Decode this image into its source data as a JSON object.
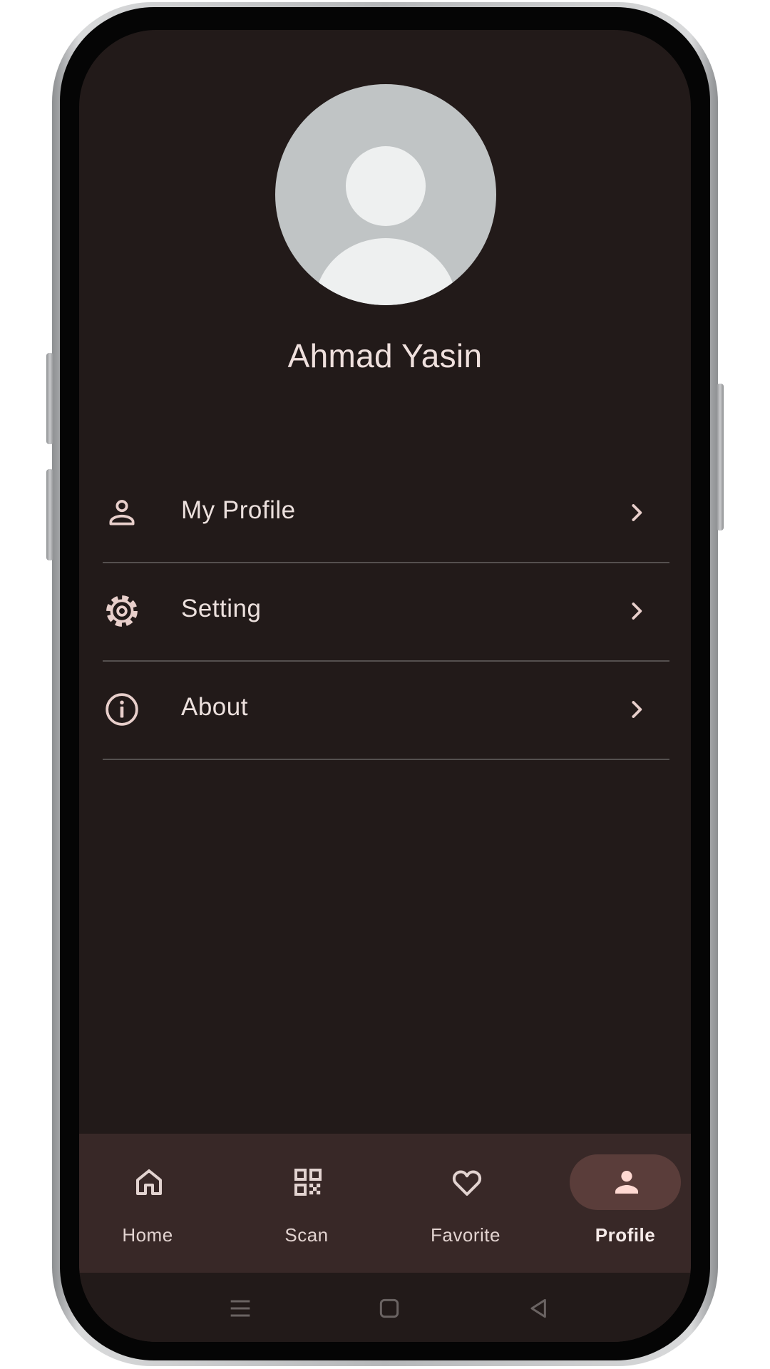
{
  "profile": {
    "name": "Ahmad Yasin",
    "avatar_icon": "default-avatar-placeholder"
  },
  "menu": {
    "items": [
      {
        "label": "My Profile",
        "icon": "person-outline-icon"
      },
      {
        "label": "Setting",
        "icon": "gear-icon"
      },
      {
        "label": "About",
        "icon": "info-circle-icon"
      }
    ],
    "chevron_icon": "chevron-right-icon"
  },
  "bottom_nav": {
    "items": [
      {
        "label": "Home",
        "icon": "home-icon",
        "active": false
      },
      {
        "label": "Scan",
        "icon": "qr-code-icon",
        "active": false
      },
      {
        "label": "Favorite",
        "icon": "heart-icon",
        "active": false
      },
      {
        "label": "Profile",
        "icon": "person-filled-icon",
        "active": true
      }
    ]
  },
  "system_nav": {
    "buttons": [
      "recents-icon",
      "home-square-icon",
      "back-triangle-icon"
    ]
  },
  "colors": {
    "background": "#221a19",
    "nav_bar": "#382827",
    "active_pill": "#5a3d3a",
    "text": "#efe0dd",
    "icon": "#e8cfcb",
    "divider": "#55504f"
  }
}
